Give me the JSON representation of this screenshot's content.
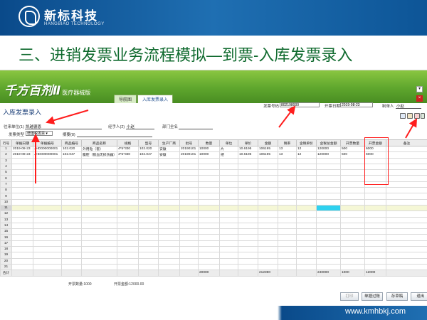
{
  "brand": {
    "name_cn": "新标科技",
    "name_en": "HANGBIAO TECHNOLOGY"
  },
  "slide_title": "三、进销发票业务流程模拟—到票-入库发票录入",
  "app": {
    "logo": "千方百剂Ⅱ",
    "edition": "医疗器械版",
    "tabs": [
      {
        "label": "导航图",
        "active": false
      },
      {
        "label": "入库发票录入",
        "active": true
      }
    ]
  },
  "form": {
    "title": "入库发票录入",
    "invoice_no_label": "发票号码",
    "invoice_no": "802198000",
    "invoice_date_label": "开票日期",
    "invoice_date": "2019-08-23",
    "maker_label": "制单人",
    "maker": "小赵",
    "supplier_label": "往来单位(1)",
    "supplier": "凯越德恩",
    "handler_label": "经手人(2)",
    "handler": "小赵",
    "dept_label": "部门全名",
    "dept": "",
    "type_label": "发票类型",
    "type": "增值税发票",
    "note_label": "摘要(8)",
    "note": ""
  },
  "grid": {
    "columns": [
      "行号",
      "单据日期",
      "单据编号",
      "商品编号",
      "商品名称",
      "规格",
      "型号",
      "生产厂商",
      "批号",
      "数量",
      "单位",
      "单价",
      "金额",
      "税率",
      "含税单价",
      "含税总金额",
      "开票数量",
      "开票金额",
      "备注"
    ],
    "rows": [
      [
        "1",
        "2019-08-23",
        "JHD000000001",
        "102.020",
        "外用贴（套）",
        "4*5*330",
        "102.020",
        "安徽",
        "20190101",
        "10000",
        "片",
        "10.6195",
        "106195",
        "13",
        "12",
        "120000",
        "500",
        "6000",
        ""
      ],
      [
        "2",
        "2019-08-23",
        "JHD000000001",
        "102.047",
        "腹腔（锁血无损伤器）",
        "4*5*330",
        "102.047",
        "安徽",
        "20190101",
        "10000",
        "把",
        "10.6195",
        "106195",
        "13",
        "12",
        "120000",
        "500",
        "6000",
        ""
      ],
      [
        "3",
        "",
        "",
        "",
        "",
        "",
        "",
        "",
        "",
        "",
        "",
        "",
        "",
        "",
        "",
        "",
        "",
        "",
        ""
      ],
      [
        "4",
        "",
        "",
        "",
        "",
        "",
        "",
        "",
        "",
        "",
        "",
        "",
        "",
        "",
        "",
        "",
        "",
        "",
        ""
      ],
      [
        "5",
        "",
        "",
        "",
        "",
        "",
        "",
        "",
        "",
        "",
        "",
        "",
        "",
        "",
        "",
        "",
        "",
        "",
        ""
      ],
      [
        "6",
        "",
        "",
        "",
        "",
        "",
        "",
        "",
        "",
        "",
        "",
        "",
        "",
        "",
        "",
        "",
        "",
        "",
        ""
      ],
      [
        "7",
        "",
        "",
        "",
        "",
        "",
        "",
        "",
        "",
        "",
        "",
        "",
        "",
        "",
        "",
        "",
        "",
        "",
        ""
      ],
      [
        "8",
        "",
        "",
        "",
        "",
        "",
        "",
        "",
        "",
        "",
        "",
        "",
        "",
        "",
        "",
        "",
        "",
        "",
        ""
      ],
      [
        "9",
        "",
        "",
        "",
        "",
        "",
        "",
        "",
        "",
        "",
        "",
        "",
        "",
        "",
        "",
        "",
        "",
        "",
        ""
      ],
      [
        "10",
        "",
        "",
        "",
        "",
        "",
        "",
        "",
        "",
        "",
        "",
        "",
        "",
        "",
        "",
        "",
        "",
        "",
        ""
      ],
      [
        "11",
        "",
        "",
        "",
        "",
        "",
        "",
        "",
        "",
        "",
        "",
        "",
        "",
        "",
        "",
        "",
        "",
        "",
        ""
      ],
      [
        "12",
        "",
        "",
        "",
        "",
        "",
        "",
        "",
        "",
        "",
        "",
        "",
        "",
        "",
        "",
        "",
        "",
        "",
        ""
      ],
      [
        "13",
        "",
        "",
        "",
        "",
        "",
        "",
        "",
        "",
        "",
        "",
        "",
        "",
        "",
        "",
        "",
        "",
        "",
        ""
      ],
      [
        "14",
        "",
        "",
        "",
        "",
        "",
        "",
        "",
        "",
        "",
        "",
        "",
        "",
        "",
        "",
        "",
        "",
        "",
        ""
      ],
      [
        "15",
        "",
        "",
        "",
        "",
        "",
        "",
        "",
        "",
        "",
        "",
        "",
        "",
        "",
        "",
        "",
        "",
        "",
        ""
      ],
      [
        "16",
        "",
        "",
        "",
        "",
        "",
        "",
        "",
        "",
        "",
        "",
        "",
        "",
        "",
        "",
        "",
        "",
        "",
        ""
      ],
      [
        "17",
        "",
        "",
        "",
        "",
        "",
        "",
        "",
        "",
        "",
        "",
        "",
        "",
        "",
        "",
        "",
        "",
        "",
        ""
      ],
      [
        "18",
        "",
        "",
        "",
        "",
        "",
        "",
        "",
        "",
        "",
        "",
        "",
        "",
        "",
        "",
        "",
        "",
        "",
        ""
      ],
      [
        "19",
        "",
        "",
        "",
        "",
        "",
        "",
        "",
        "",
        "",
        "",
        "",
        "",
        "",
        "",
        "",
        "",
        "",
        ""
      ],
      [
        "20",
        "",
        "",
        "",
        "",
        "",
        "",
        "",
        "",
        "",
        "",
        "",
        "",
        "",
        "",
        "",
        "",
        "",
        ""
      ],
      [
        "21",
        "",
        "",
        "",
        "",
        "",
        "",
        "",
        "",
        "",
        "",
        "",
        "",
        "",
        "",
        "",
        "",
        "",
        ""
      ]
    ],
    "selected_row": 11,
    "total": [
      "合计",
      "",
      "",
      "",
      "",
      "",
      "",
      "",
      "",
      "20000",
      "",
      "",
      "212390",
      "",
      "",
      "240000",
      "1000",
      "12000",
      ""
    ]
  },
  "summary": {
    "qty_label": "开票数量",
    "qty": "1000",
    "amount_label": "开票金额",
    "amount": "12000.00"
  },
  "buttons": {
    "print": "打印",
    "filter": "单据过账",
    "draft": "存草稿",
    "exit": "退出"
  },
  "footer": {
    "website": "www.kmhbkj.com"
  },
  "colors": {
    "header_blue": "#0a4a8a",
    "app_green": "#5ea62d",
    "title_green": "#0f6a2e",
    "annotation_red": "#ff1d1d",
    "highlight_cyan": "#2ed1ef"
  }
}
